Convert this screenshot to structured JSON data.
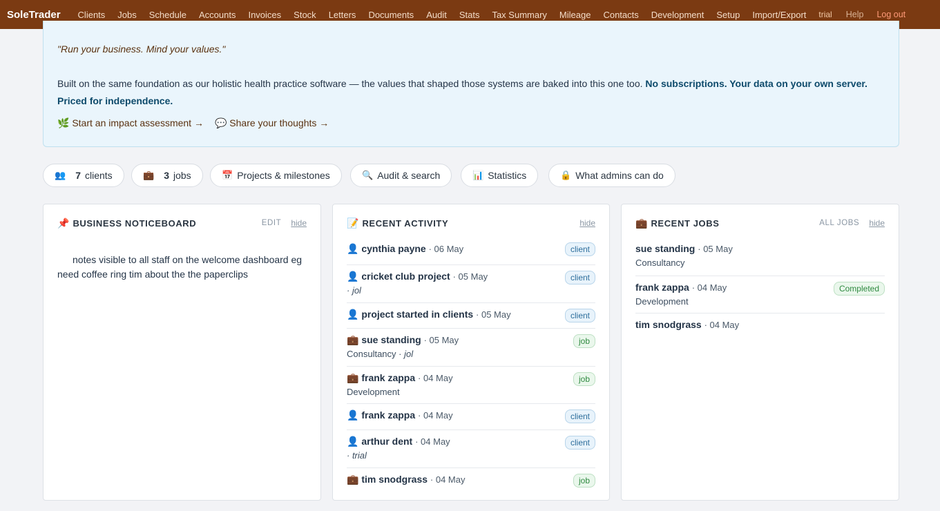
{
  "nav": {
    "brand": "SoleTrader",
    "links": [
      "Clients",
      "Jobs",
      "Schedule",
      "Accounts",
      "Invoices",
      "Stock",
      "Letters",
      "Documents",
      "Audit",
      "Stats",
      "Tax Summary",
      "Mileage",
      "Contacts",
      "Development",
      "Setup",
      "Import/Export"
    ],
    "trial": "trial",
    "help": "Help",
    "logout": "Log out"
  },
  "banner": {
    "quote": "\"Run your business. Mind your values.\"",
    "desc_plain": "Built on the same foundation as our holistic health practice software — the values that shaped those systems are baked into this one too.",
    "desc_bold": "No subscriptions. Your data on your own server. Priced for independence.",
    "link_assessment": "Start an impact assessment →",
    "link_thoughts": "Share your thoughts →"
  },
  "pills": {
    "clients_count": "7",
    "clients_label": "clients",
    "jobs_count": "3",
    "jobs_label": "jobs",
    "projects": "Projects & milestones",
    "audit": "Audit & search",
    "statistics": "Statistics",
    "admins": "What admins can do"
  },
  "noticeboard": {
    "title": "BUSINESS NOTICEBOARD",
    "edit": "EDIT",
    "hide": "hide",
    "text": "notes visible to all staff on the welcome dashboard eg need coffee ring tim about the the paperclips"
  },
  "activity": {
    "title": "RECENT ACTIVITY",
    "hide": "hide",
    "items": [
      {
        "kind": "client",
        "name": "cynthia payne",
        "date": "· 06 May",
        "sub": "",
        "tag": "client"
      },
      {
        "kind": "client",
        "name": "cricket club project",
        "date": "· 05 May",
        "sub": "· jol",
        "tag": "client"
      },
      {
        "kind": "client",
        "name": "project started in clients",
        "date": "· 05 May",
        "sub": "",
        "tag": "client"
      },
      {
        "kind": "job",
        "name": "sue standing",
        "date": "· 05 May",
        "sub": "Consultancy · jol",
        "tag": "job"
      },
      {
        "kind": "job",
        "name": "frank zappa",
        "date": "· 04 May",
        "sub": "Development",
        "tag": "job"
      },
      {
        "kind": "client",
        "name": "frank zappa",
        "date": "· 04 May",
        "sub": "",
        "tag": "client"
      },
      {
        "kind": "client",
        "name": "arthur dent",
        "date": "· 04 May",
        "sub": "· trial",
        "tag": "client"
      },
      {
        "kind": "job",
        "name": "tim snodgrass",
        "date": "· 04 May",
        "sub": "",
        "tag": "job"
      }
    ]
  },
  "jobs": {
    "title": "RECENT JOBS",
    "all_jobs": "ALL JOBS",
    "hide": "hide",
    "items": [
      {
        "name": "sue standing",
        "date": "· 05 May",
        "sub": "Consultancy",
        "status": ""
      },
      {
        "name": "frank zappa",
        "date": "· 04 May",
        "sub": "Development",
        "status": "Completed"
      },
      {
        "name": "tim snodgrass",
        "date": "· 04 May",
        "sub": "",
        "status": ""
      }
    ]
  }
}
